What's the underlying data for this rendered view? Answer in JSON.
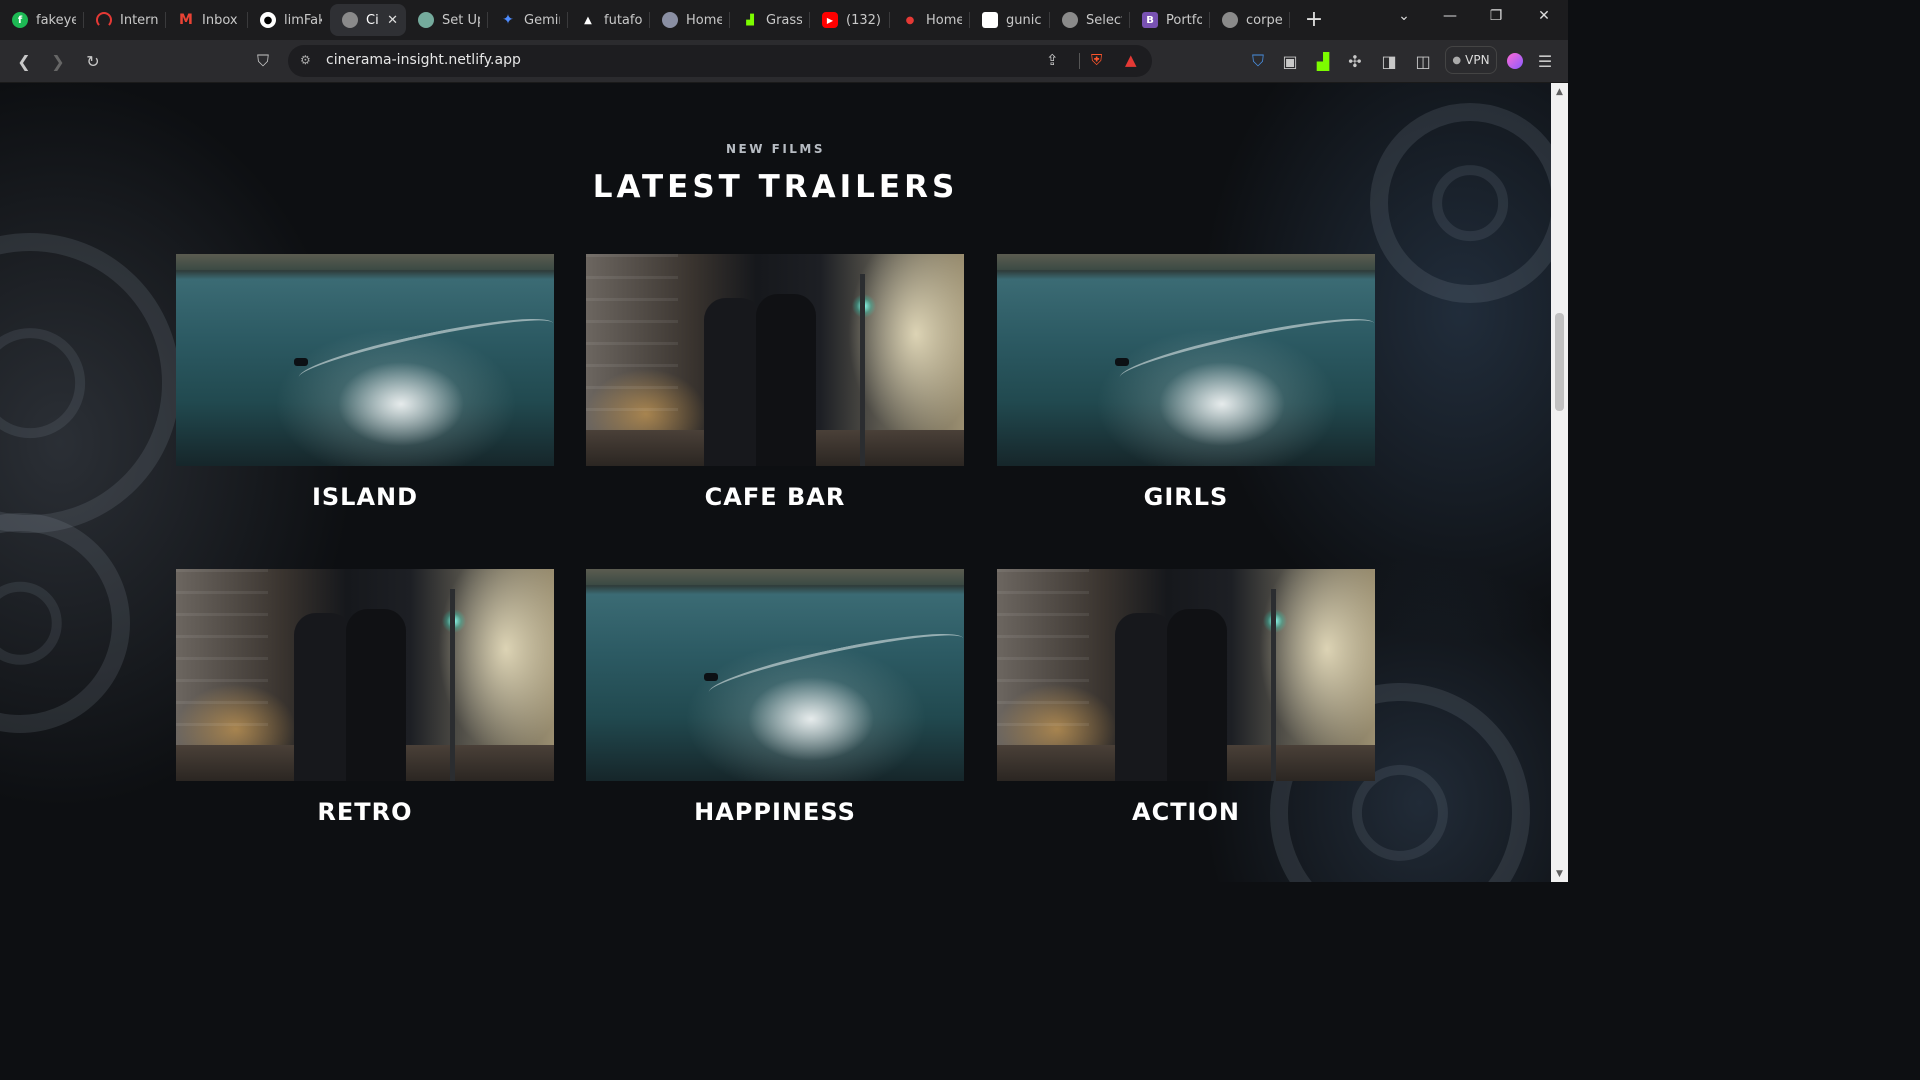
{
  "browser": {
    "tabs": [
      {
        "title": "fakeye",
        "icon": "green-f-icon",
        "color": "#1db954",
        "active": false
      },
      {
        "title": "Intern",
        "icon": "red-arc-icon",
        "color": "#e53935",
        "active": false
      },
      {
        "title": "Inbox",
        "icon": "gmail-icon",
        "color": "#ea4335",
        "active": false
      },
      {
        "title": "limFak",
        "icon": "github-icon",
        "color": "#ffffff",
        "active": false
      },
      {
        "title": "Ci",
        "icon": "globe-icon",
        "color": "#9e9e9e",
        "active": true
      },
      {
        "title": "Set Up",
        "icon": "openai-icon",
        "color": "#74aa9c",
        "active": false
      },
      {
        "title": "Gemin",
        "icon": "gemini-icon",
        "color": "#4e8cff",
        "active": false
      },
      {
        "title": "futafo",
        "icon": "triangle-icon",
        "color": "#ffffff",
        "active": false
      },
      {
        "title": "Home",
        "icon": "avatar-icon",
        "color": "#8a8fa3",
        "active": false
      },
      {
        "title": "Grass",
        "icon": "grass-icon",
        "color": "#7cfc00",
        "active": false
      },
      {
        "title": "(132)",
        "icon": "youtube-icon",
        "color": "#ff0000",
        "active": false
      },
      {
        "title": "Home",
        "icon": "red-figure-icon",
        "color": "#e53935",
        "active": false
      },
      {
        "title": "gunico",
        "icon": "gunicorn-icon",
        "color": "#ffffff",
        "active": false
      },
      {
        "title": "Select",
        "icon": "globe-icon",
        "color": "#9e9e9e",
        "active": false
      },
      {
        "title": "Portfo",
        "icon": "bootstrap-icon",
        "color": "#7952b3",
        "active": false
      },
      {
        "title": "corpe",
        "icon": "globe-icon",
        "color": "#9e9e9e",
        "active": false
      }
    ],
    "close_tab_glyph": "✕",
    "new_tab_glyph": "+",
    "url": "cinerama-insight.netlify.app",
    "vpn_label": "VPN"
  },
  "page": {
    "eyebrow": "NEW FILMS",
    "heading": "LATEST TRAILERS",
    "trailers": [
      {
        "title": "ISLAND",
        "thumbnail": "island"
      },
      {
        "title": "CAFE BAR",
        "thumbnail": "city"
      },
      {
        "title": "GIRLS",
        "thumbnail": "island"
      },
      {
        "title": "RETRO",
        "thumbnail": "city"
      },
      {
        "title": "HAPPINESS",
        "thumbnail": "island"
      },
      {
        "title": "ACTION",
        "thumbnail": "city"
      }
    ]
  }
}
